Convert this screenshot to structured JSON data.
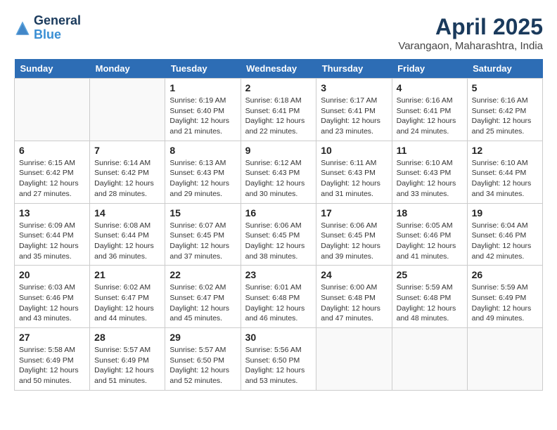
{
  "logo": {
    "general": "General",
    "blue": "Blue"
  },
  "title": "April 2025",
  "location": "Varangaon, Maharashtra, India",
  "days_of_week": [
    "Sunday",
    "Monday",
    "Tuesday",
    "Wednesday",
    "Thursday",
    "Friday",
    "Saturday"
  ],
  "weeks": [
    [
      {
        "day": "",
        "sunrise": "",
        "sunset": "",
        "daylight": ""
      },
      {
        "day": "",
        "sunrise": "",
        "sunset": "",
        "daylight": ""
      },
      {
        "day": "1",
        "sunrise": "Sunrise: 6:19 AM",
        "sunset": "Sunset: 6:40 PM",
        "daylight": "Daylight: 12 hours and 21 minutes."
      },
      {
        "day": "2",
        "sunrise": "Sunrise: 6:18 AM",
        "sunset": "Sunset: 6:41 PM",
        "daylight": "Daylight: 12 hours and 22 minutes."
      },
      {
        "day": "3",
        "sunrise": "Sunrise: 6:17 AM",
        "sunset": "Sunset: 6:41 PM",
        "daylight": "Daylight: 12 hours and 23 minutes."
      },
      {
        "day": "4",
        "sunrise": "Sunrise: 6:16 AM",
        "sunset": "Sunset: 6:41 PM",
        "daylight": "Daylight: 12 hours and 24 minutes."
      },
      {
        "day": "5",
        "sunrise": "Sunrise: 6:16 AM",
        "sunset": "Sunset: 6:42 PM",
        "daylight": "Daylight: 12 hours and 25 minutes."
      }
    ],
    [
      {
        "day": "6",
        "sunrise": "Sunrise: 6:15 AM",
        "sunset": "Sunset: 6:42 PM",
        "daylight": "Daylight: 12 hours and 27 minutes."
      },
      {
        "day": "7",
        "sunrise": "Sunrise: 6:14 AM",
        "sunset": "Sunset: 6:42 PM",
        "daylight": "Daylight: 12 hours and 28 minutes."
      },
      {
        "day": "8",
        "sunrise": "Sunrise: 6:13 AM",
        "sunset": "Sunset: 6:43 PM",
        "daylight": "Daylight: 12 hours and 29 minutes."
      },
      {
        "day": "9",
        "sunrise": "Sunrise: 6:12 AM",
        "sunset": "Sunset: 6:43 PM",
        "daylight": "Daylight: 12 hours and 30 minutes."
      },
      {
        "day": "10",
        "sunrise": "Sunrise: 6:11 AM",
        "sunset": "Sunset: 6:43 PM",
        "daylight": "Daylight: 12 hours and 31 minutes."
      },
      {
        "day": "11",
        "sunrise": "Sunrise: 6:10 AM",
        "sunset": "Sunset: 6:43 PM",
        "daylight": "Daylight: 12 hours and 33 minutes."
      },
      {
        "day": "12",
        "sunrise": "Sunrise: 6:10 AM",
        "sunset": "Sunset: 6:44 PM",
        "daylight": "Daylight: 12 hours and 34 minutes."
      }
    ],
    [
      {
        "day": "13",
        "sunrise": "Sunrise: 6:09 AM",
        "sunset": "Sunset: 6:44 PM",
        "daylight": "Daylight: 12 hours and 35 minutes."
      },
      {
        "day": "14",
        "sunrise": "Sunrise: 6:08 AM",
        "sunset": "Sunset: 6:44 PM",
        "daylight": "Daylight: 12 hours and 36 minutes."
      },
      {
        "day": "15",
        "sunrise": "Sunrise: 6:07 AM",
        "sunset": "Sunset: 6:45 PM",
        "daylight": "Daylight: 12 hours and 37 minutes."
      },
      {
        "day": "16",
        "sunrise": "Sunrise: 6:06 AM",
        "sunset": "Sunset: 6:45 PM",
        "daylight": "Daylight: 12 hours and 38 minutes."
      },
      {
        "day": "17",
        "sunrise": "Sunrise: 6:06 AM",
        "sunset": "Sunset: 6:45 PM",
        "daylight": "Daylight: 12 hours and 39 minutes."
      },
      {
        "day": "18",
        "sunrise": "Sunrise: 6:05 AM",
        "sunset": "Sunset: 6:46 PM",
        "daylight": "Daylight: 12 hours and 41 minutes."
      },
      {
        "day": "19",
        "sunrise": "Sunrise: 6:04 AM",
        "sunset": "Sunset: 6:46 PM",
        "daylight": "Daylight: 12 hours and 42 minutes."
      }
    ],
    [
      {
        "day": "20",
        "sunrise": "Sunrise: 6:03 AM",
        "sunset": "Sunset: 6:46 PM",
        "daylight": "Daylight: 12 hours and 43 minutes."
      },
      {
        "day": "21",
        "sunrise": "Sunrise: 6:02 AM",
        "sunset": "Sunset: 6:47 PM",
        "daylight": "Daylight: 12 hours and 44 minutes."
      },
      {
        "day": "22",
        "sunrise": "Sunrise: 6:02 AM",
        "sunset": "Sunset: 6:47 PM",
        "daylight": "Daylight: 12 hours and 45 minutes."
      },
      {
        "day": "23",
        "sunrise": "Sunrise: 6:01 AM",
        "sunset": "Sunset: 6:48 PM",
        "daylight": "Daylight: 12 hours and 46 minutes."
      },
      {
        "day": "24",
        "sunrise": "Sunrise: 6:00 AM",
        "sunset": "Sunset: 6:48 PM",
        "daylight": "Daylight: 12 hours and 47 minutes."
      },
      {
        "day": "25",
        "sunrise": "Sunrise: 5:59 AM",
        "sunset": "Sunset: 6:48 PM",
        "daylight": "Daylight: 12 hours and 48 minutes."
      },
      {
        "day": "26",
        "sunrise": "Sunrise: 5:59 AM",
        "sunset": "Sunset: 6:49 PM",
        "daylight": "Daylight: 12 hours and 49 minutes."
      }
    ],
    [
      {
        "day": "27",
        "sunrise": "Sunrise: 5:58 AM",
        "sunset": "Sunset: 6:49 PM",
        "daylight": "Daylight: 12 hours and 50 minutes."
      },
      {
        "day": "28",
        "sunrise": "Sunrise: 5:57 AM",
        "sunset": "Sunset: 6:49 PM",
        "daylight": "Daylight: 12 hours and 51 minutes."
      },
      {
        "day": "29",
        "sunrise": "Sunrise: 5:57 AM",
        "sunset": "Sunset: 6:50 PM",
        "daylight": "Daylight: 12 hours and 52 minutes."
      },
      {
        "day": "30",
        "sunrise": "Sunrise: 5:56 AM",
        "sunset": "Sunset: 6:50 PM",
        "daylight": "Daylight: 12 hours and 53 minutes."
      },
      {
        "day": "",
        "sunrise": "",
        "sunset": "",
        "daylight": ""
      },
      {
        "day": "",
        "sunrise": "",
        "sunset": "",
        "daylight": ""
      },
      {
        "day": "",
        "sunrise": "",
        "sunset": "",
        "daylight": ""
      }
    ]
  ]
}
